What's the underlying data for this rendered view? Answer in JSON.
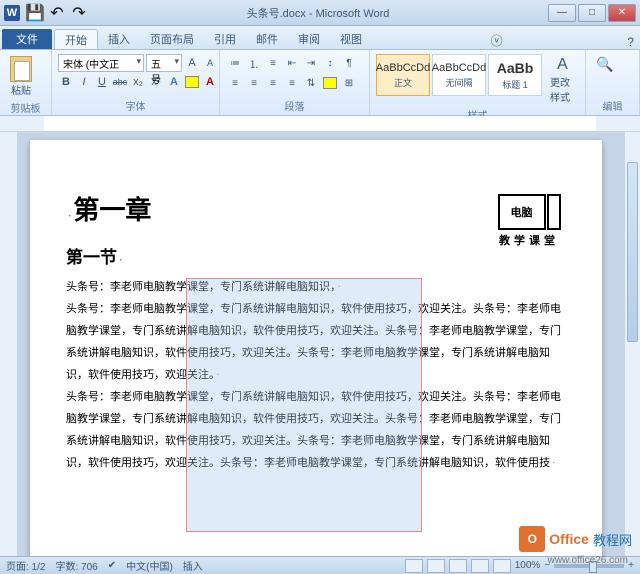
{
  "title": "头条号.docx - Microsoft Word",
  "qat": {
    "word": "W"
  },
  "tabs": {
    "file": "文件",
    "items": [
      "开始",
      "插入",
      "页面布局",
      "引用",
      "邮件",
      "审阅",
      "视图"
    ],
    "active": 0
  },
  "ribbon": {
    "clipboard": {
      "paste": "粘贴",
      "label": "剪贴板"
    },
    "font": {
      "name": "宋体 (中文正",
      "size": "五号",
      "label": "字体",
      "bold": "B",
      "italic": "I",
      "underline": "U",
      "strike": "abc",
      "sub": "x₂",
      "sup": "x²"
    },
    "paragraph": {
      "label": "段落"
    },
    "styles": {
      "label": "样式",
      "items": [
        {
          "preview": "AaBbCcDd",
          "name": "正文"
        },
        {
          "preview": "AaBbCcDd",
          "name": "无间隔"
        },
        {
          "preview": "AaBb",
          "name": "标题 1"
        }
      ],
      "change": "更改样式"
    },
    "editing": {
      "label": "编辑"
    }
  },
  "doc": {
    "h1": "第一章",
    "h2": "第一节",
    "p1": "头条号：李老师电脑教学课堂，专门系统讲解电脑知识，",
    "p2": "头条号：李老师电脑教学课堂，专门系统讲解电脑知识，软件使用技巧，欢迎关注。头条号：李老师电脑教学课堂，专门系统讲解电脑知识，软件使用技巧，欢迎关注。头条号：李老师电脑教学课堂，专门系统讲解电脑知识，软件使用技巧，欢迎关注。头条号：李老师电脑教学课堂，专门系统讲解电脑知识，软件使用技巧，欢迎关注。",
    "p3": "头条号：李老师电脑教学课堂，专门系统讲解电脑知识，软件使用技巧，欢迎关注。头条号：李老师电脑教学课堂，专门系统讲解电脑知识，软件使用技巧，欢迎关注。头条号：李老师电脑教学课堂，专门系统讲解电脑知识，软件使用技巧，欢迎关注。头条号：李老师电脑教学课堂，专门系统讲解电脑知识，软件使用技巧，欢迎关注。头条号：李老师电脑教学课堂，专门系统讲解电脑知识，软件使用技",
    "img_text": "电脑",
    "img_caption": "教学课堂"
  },
  "status": {
    "page": "页面: 1/2",
    "words": "字数: 706",
    "lang": "中文(中国)",
    "mode": "插入",
    "zoom": "100%",
    "minus": "−",
    "plus": "+"
  },
  "watermark": {
    "logo": "O",
    "text1": "Office",
    "text2": "教程网",
    "url": "www.office26.com"
  },
  "colors": {
    "highlight_yellow": "#ffff00",
    "font_red": "#c00000"
  }
}
